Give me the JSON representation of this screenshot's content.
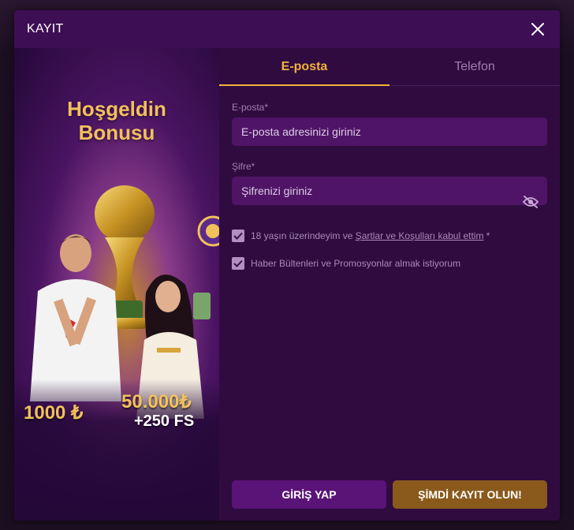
{
  "modal": {
    "title": "KAYIT"
  },
  "promo": {
    "title_line1": "Hoşgeldin",
    "title_line2": "Bonusu",
    "bonus_amount": "1000 ₺",
    "bonus_max": "50.000₺",
    "bonus_fs": "+250 FS"
  },
  "tabs": [
    {
      "label": "E-posta",
      "active": true
    },
    {
      "label": "Telefon",
      "active": false
    }
  ],
  "form": {
    "email_label": "E-posta*",
    "email_placeholder": "E-posta adresinizi giriniz",
    "password_label": "Şifre*",
    "password_placeholder": "Şifrenizi giriniz",
    "terms_prefix": "18 yaşın üzerindeyim ve ",
    "terms_link": "Şartlar ve Koşulları kabul ettim",
    "terms_suffix": " *",
    "newsletter": "Haber Bültenleri ve Promosyonlar almak istiyorum",
    "terms_checked": true,
    "newsletter_checked": true
  },
  "buttons": {
    "login": "GİRİŞ YAP",
    "register": "ŞİMDİ KAYIT OLUN!"
  },
  "colors": {
    "accent": "#f1b33a",
    "panel": "#300b40",
    "input": "#4f1466",
    "login_button": "#5a1478",
    "register_button": "#8a5a1c"
  },
  "icons": {
    "close": "close-icon",
    "eye": "eye-off-icon",
    "check": "check-icon"
  }
}
